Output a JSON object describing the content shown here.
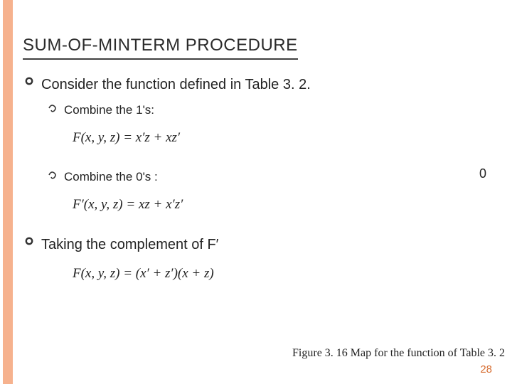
{
  "title": "SUM-OF-MINTERM PROCEDURE",
  "bullet1": "Consider the function defined in Table 3. 2.",
  "sub1": "Combine the 1's:",
  "formula1": "F(x, y, z) = x′z + xz′",
  "sub2": "Combine the 0's :",
  "right_zero": "0",
  "formula2": "F′(x, y, z) = xz + x′z′",
  "bullet2": "Taking the complement of F′",
  "formula3": "F(x, y, z) = (x′ + z′)(x + z)",
  "caption": "Figure 3. 16 Map for the function of Table 3. 2",
  "page_number": "28"
}
